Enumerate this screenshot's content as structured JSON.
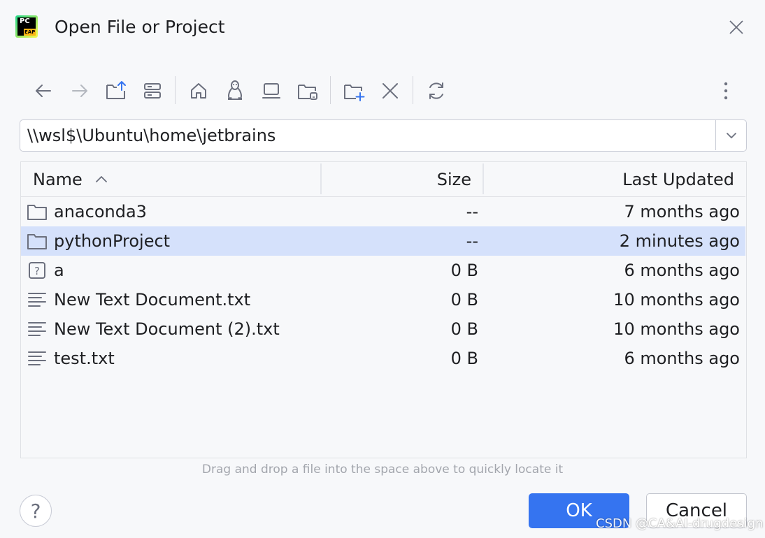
{
  "window": {
    "title": "Open File or Project",
    "app_icon": "pycharm-eap-logo",
    "logo_text": {
      "top": "PC",
      "bottom": "EAP"
    }
  },
  "toolbar": {
    "buttons": [
      {
        "name": "back",
        "icon": "arrow-left-icon"
      },
      {
        "name": "forward",
        "icon": "arrow-right-icon"
      },
      {
        "name": "parent-folder",
        "icon": "folder-up-icon"
      },
      {
        "name": "show-hidden",
        "icon": "server-icon"
      },
      {
        "name": "home",
        "icon": "home-icon"
      },
      {
        "name": "wsl",
        "icon": "linux-icon"
      },
      {
        "name": "desktop",
        "icon": "laptop-icon"
      },
      {
        "name": "project-folder",
        "icon": "folder-module-icon"
      },
      {
        "name": "new-folder",
        "icon": "new-folder-icon"
      },
      {
        "name": "delete",
        "icon": "close-icon"
      },
      {
        "name": "refresh",
        "icon": "refresh-icon"
      },
      {
        "name": "more",
        "icon": "more-vertical-icon"
      }
    ]
  },
  "path": {
    "value": "\\\\wsl$\\Ubuntu\\home\\jetbrains"
  },
  "table": {
    "columns": {
      "name": "Name",
      "size": "Size",
      "updated": "Last Updated"
    },
    "sort": "ascending",
    "rows": [
      {
        "icon": "folder-icon",
        "name": "anaconda3",
        "size": "--",
        "updated": "7 months ago",
        "selected": false
      },
      {
        "icon": "folder-icon",
        "name": "pythonProject",
        "size": "--",
        "updated": "2 minutes ago",
        "selected": true
      },
      {
        "icon": "unknown-file-icon",
        "name": "a",
        "size": "0 B",
        "updated": "6 months ago",
        "selected": false
      },
      {
        "icon": "text-file-icon",
        "name": "New Text Document.txt",
        "size": "0 B",
        "updated": "10 months ago",
        "selected": false
      },
      {
        "icon": "text-file-icon",
        "name": "New Text Document (2).txt",
        "size": "0 B",
        "updated": "10 months ago",
        "selected": false
      },
      {
        "icon": "text-file-icon",
        "name": "test.txt",
        "size": "0 B",
        "updated": "6 months ago",
        "selected": false
      }
    ]
  },
  "hint": "Drag and drop a file into the space above to quickly locate it",
  "footer": {
    "help_label": "?",
    "ok_label": "OK",
    "cancel_label": "Cancel"
  },
  "watermark": "CSDN @CA&AI-drugdesign",
  "colors": {
    "background": "#f7f8fa",
    "selection": "#d5e1fb",
    "accent": "#3574f0",
    "icon": "#6c707e"
  }
}
